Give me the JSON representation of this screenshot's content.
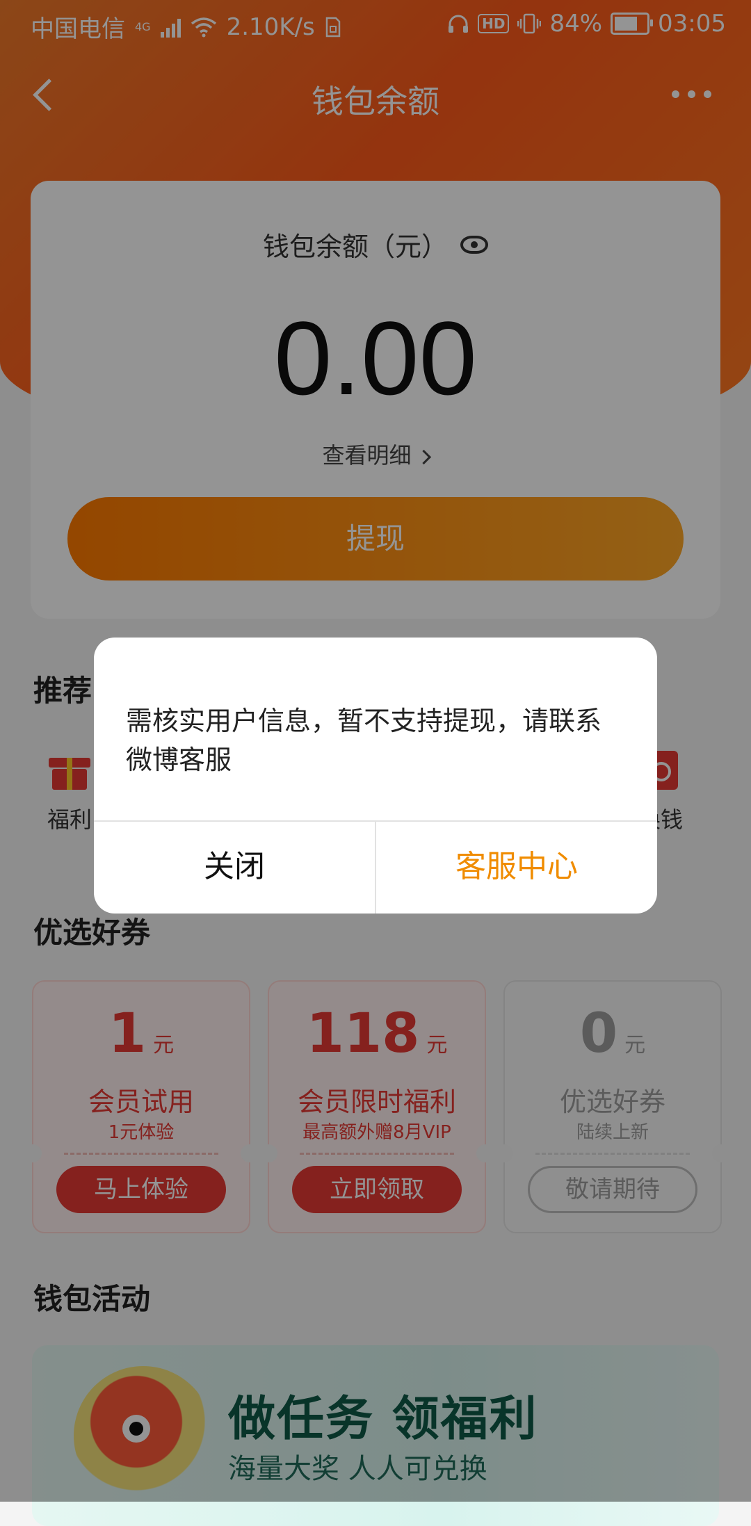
{
  "status_bar": {
    "carrier": "中国电信",
    "network_type": "4G",
    "net_speed": "2.10K/s",
    "battery_percent": "84%",
    "battery_level": 0.84,
    "time": "03:05",
    "hd_label": "HD",
    "icons": [
      "signal-icon",
      "wifi-icon",
      "sim-card-icon",
      "headphones-icon",
      "hd-icon",
      "vibrate-icon",
      "battery-icon"
    ]
  },
  "nav": {
    "title": "钱包余额",
    "back_icon": "back-chevron-icon",
    "more_icon": "more-dots-icon"
  },
  "balance_card": {
    "label": "钱包余额（元）",
    "visibility_icon": "eye-icon",
    "amount": "0.00",
    "detail_link": "查看明细",
    "withdraw_button": "提现"
  },
  "recommend": {
    "title": "推荐",
    "items": [
      {
        "label": "福利",
        "icon": "gift-icon"
      },
      {
        "label": "换钱",
        "icon": "exchange-icon"
      }
    ]
  },
  "coupons": {
    "title": "优选好券",
    "items": [
      {
        "value": "1",
        "unit": "元",
        "title": "会员试用",
        "subtitle": "1元体验",
        "button": "马上体验",
        "style": "red"
      },
      {
        "value": "118",
        "unit": "元",
        "title": "会员限时福利",
        "subtitle": "最高额外赠8月VIP",
        "button": "立即领取",
        "style": "red"
      },
      {
        "value": "0",
        "unit": "元",
        "title": "优选好券",
        "subtitle": "陆续上新",
        "button": "敬请期待",
        "style": "gray"
      }
    ]
  },
  "activities": {
    "title": "钱包活动",
    "banner_title": "做任务 领福利",
    "banner_subtitle": "海量大奖 人人可兑换"
  },
  "dialog": {
    "message": "需核实用户信息，暂不支持提现，请联系微博客服",
    "close_button": "关闭",
    "service_button": "客服中心"
  },
  "colors": {
    "header_orange": "#ff5a1a",
    "withdraw_button": "#ffa726",
    "coupon_red": "#e53935",
    "dialog_accent": "#f08c00",
    "banner_green": "#0e5a48"
  }
}
